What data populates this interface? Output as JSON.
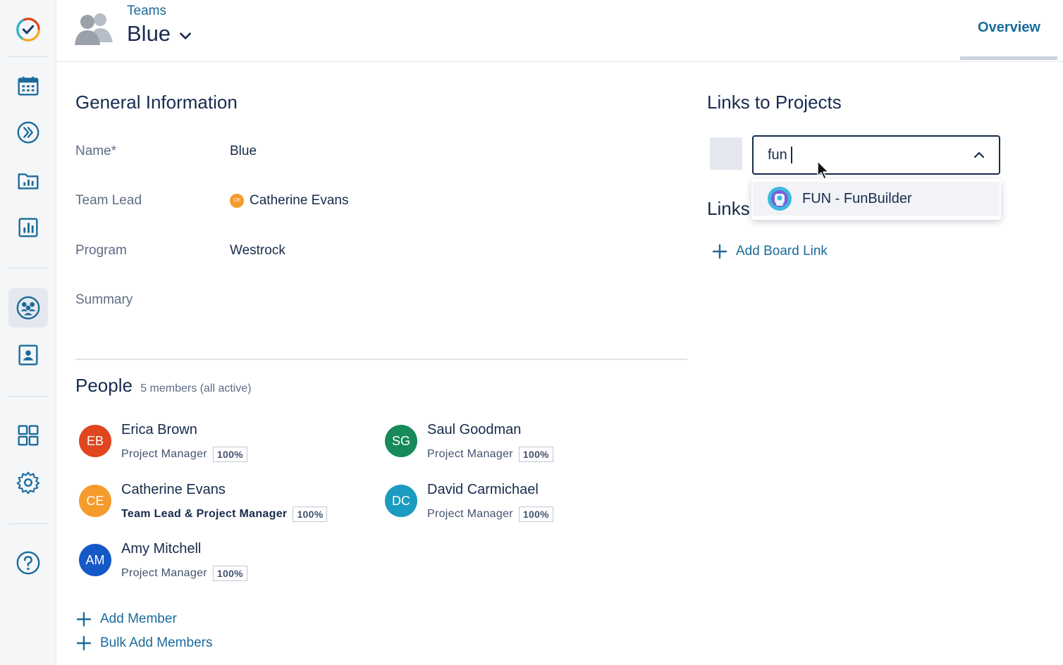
{
  "nav": {
    "items": [
      {
        "name": "app-logo-icon"
      },
      {
        "name": "calendar-icon"
      },
      {
        "name": "fast-forward-icon"
      },
      {
        "name": "folder-chart-icon"
      },
      {
        "name": "reports-icon"
      },
      {
        "name": "teams-icon",
        "active": true
      },
      {
        "name": "person-card-icon"
      },
      {
        "name": "apps-grid-icon"
      },
      {
        "name": "gear-icon"
      },
      {
        "name": "help-icon"
      }
    ]
  },
  "header": {
    "breadcrumb": "Teams",
    "title": "Blue",
    "tab": "Overview"
  },
  "general": {
    "title": "General Information",
    "fields": [
      {
        "label": "Name*",
        "value": "Blue"
      },
      {
        "label": "Team Lead",
        "value": "Catherine Evans",
        "badge": "CE"
      },
      {
        "label": "Program",
        "value": "Westrock"
      },
      {
        "label": "Summary",
        "value": ""
      }
    ]
  },
  "people": {
    "title": "People",
    "subtitle": "5 members (all active)",
    "members": [
      {
        "initials": "EB",
        "name": "Erica Brown",
        "role": "Project Manager",
        "pct": "100%",
        "color": "#e0461f"
      },
      {
        "initials": "SG",
        "name": "Saul Goodman",
        "role": "Project Manager",
        "pct": "100%",
        "color": "#178a5a"
      },
      {
        "initials": "CE",
        "name": "Catherine Evans",
        "role": "Team Lead & Project Manager",
        "pct": "100%",
        "color": "#f59b2c"
      },
      {
        "initials": "DC",
        "name": "David Carmichael",
        "role": "Project Manager",
        "pct": "100%",
        "color": "#1a9bbf"
      },
      {
        "initials": "AM",
        "name": "Amy Mitchell",
        "role": "Project Manager",
        "pct": "100%",
        "color": "#1558c7"
      }
    ],
    "add_member": "Add Member",
    "bulk_add": "Bulk Add Members"
  },
  "projects": {
    "title": "Links to Projects",
    "search_value": "fun",
    "option": "FUN - FunBuilder"
  },
  "links": {
    "title": "Links",
    "add_board": "Add Board Link"
  },
  "colors": {
    "accent": "#1a6b9a",
    "text": "#172b4d",
    "muted": "#5e6c84"
  }
}
